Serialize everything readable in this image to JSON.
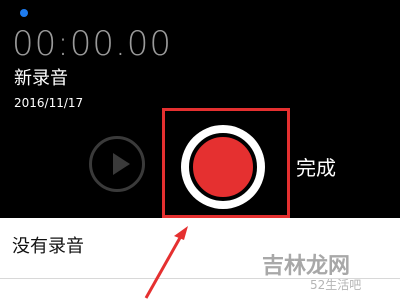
{
  "recorder": {
    "timer": "00:00.00",
    "recording_name": "新录音",
    "recording_date": "2016/11/17",
    "play_icon": "play-icon",
    "record_icon": "record-icon",
    "done_label": "完成"
  },
  "list": {
    "empty_text": "没有录音"
  },
  "watermark": {
    "main": "吉林龙网",
    "sub": "52生活吧"
  },
  "colors": {
    "record_red": "#e53030",
    "annotation_red": "#e53030",
    "status_dot_blue": "#1e7cf0"
  }
}
